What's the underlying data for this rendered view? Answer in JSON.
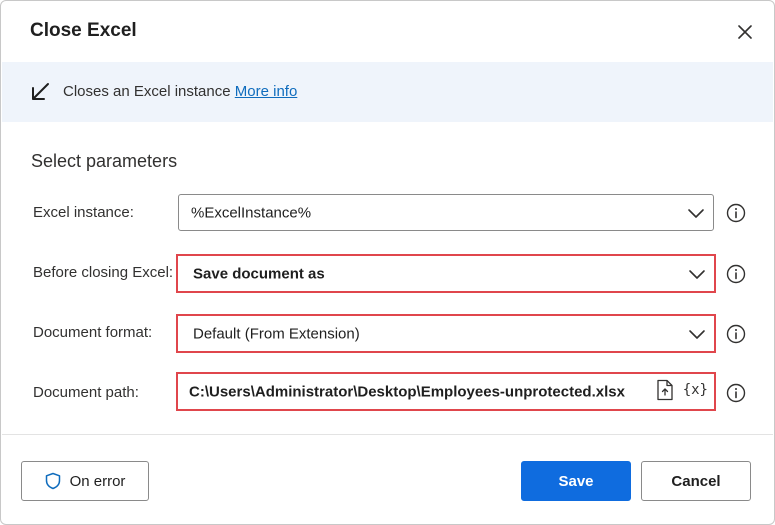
{
  "dialog": {
    "title": "Close Excel"
  },
  "banner": {
    "description": "Closes an Excel instance",
    "more_info_link": "More info"
  },
  "section_title": "Select parameters",
  "parameters": [
    {
      "label": "Excel instance:",
      "value": "%ExcelInstance%",
      "kind": "dropdown",
      "highlighted": false
    },
    {
      "label": "Before closing Excel:",
      "value": "Save document as",
      "kind": "dropdown",
      "highlighted": true
    },
    {
      "label": "Document format:",
      "value": "Default (From Extension)",
      "kind": "dropdown",
      "highlighted": true
    },
    {
      "label": "Document path:",
      "value": "C:\\Users\\Administrator\\Desktop\\Employees-unprotected.xlsx",
      "kind": "file-path",
      "highlighted": true
    }
  ],
  "path_field": {
    "variable_icon_text": "{x}"
  },
  "footer": {
    "on_error_label": "On error",
    "save_label": "Save",
    "cancel_label": "Cancel"
  },
  "colors": {
    "accent": "#0f6cdf",
    "highlight_border": "#e0464c",
    "banner_bg": "#eff4fb",
    "link": "#0f6cbd"
  },
  "icons": {
    "close": "close-icon",
    "banner": "arrow-down-left-icon",
    "dropdown": "chevron-down-icon",
    "info": "info-icon",
    "file": "file-icon",
    "variable": "variable-icon",
    "on_error": "shield-icon"
  }
}
